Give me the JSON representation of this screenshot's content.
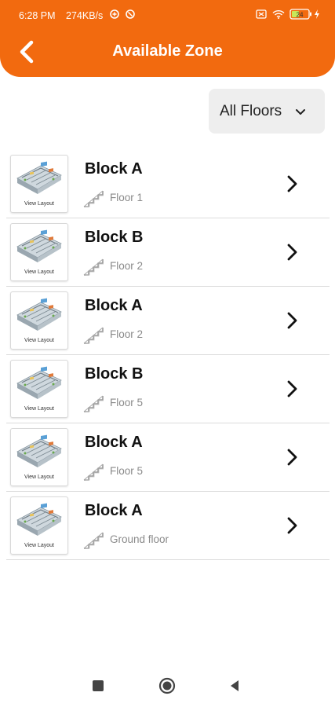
{
  "status_bar": {
    "time": "6:28 PM",
    "speed": "274KB/s",
    "battery": "24"
  },
  "header": {
    "title": "Available Zone",
    "background": "#f26a0f"
  },
  "filter": {
    "selected": "All Floors"
  },
  "zones": [
    {
      "block": "Block A",
      "floor": "Floor 1",
      "thumb_label": "View Layout"
    },
    {
      "block": "Block B",
      "floor": "Floor 2",
      "thumb_label": "View Layout"
    },
    {
      "block": "Block A",
      "floor": "Floor 2",
      "thumb_label": "View Layout"
    },
    {
      "block": "Block B",
      "floor": "Floor 5",
      "thumb_label": "View Layout"
    },
    {
      "block": "Block A",
      "floor": "Floor 5",
      "thumb_label": "View Layout"
    },
    {
      "block": "Block A",
      "floor": "Ground floor",
      "thumb_label": "View Layout"
    }
  ]
}
